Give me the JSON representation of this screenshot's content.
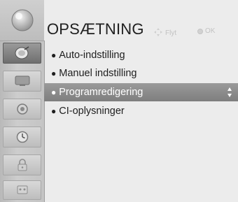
{
  "header": {
    "title": "OPSÆTNING",
    "hints": {
      "move_label": "Flyt",
      "move_icon": "navigation-arrows-icon",
      "ok_label": "OK",
      "ok_icon": "ok-button-icon"
    }
  },
  "sidebar": {
    "logo_icon": "tv-logo-icon",
    "items": [
      {
        "icon": "setup-satellite-icon",
        "active": true
      },
      {
        "icon": "picture-icon",
        "active": false
      },
      {
        "icon": "audio-icon",
        "active": false
      },
      {
        "icon": "time-clock-icon",
        "active": false
      },
      {
        "icon": "lock-icon",
        "active": false
      },
      {
        "icon": "options-icon",
        "active": false
      }
    ]
  },
  "menu": {
    "items": [
      {
        "label": "Auto-indstilling",
        "selected": false
      },
      {
        "label": "Manuel indstilling",
        "selected": false
      },
      {
        "label": "Programredigering",
        "selected": true
      },
      {
        "label": "CI-oplysninger",
        "selected": false
      }
    ],
    "selection_indicator_icon": "up-down-arrows-icon"
  },
  "colors": {
    "selected_row": "#8a8a8a",
    "text": "#1e1e1e",
    "hint_text": "#c2c2c2"
  }
}
